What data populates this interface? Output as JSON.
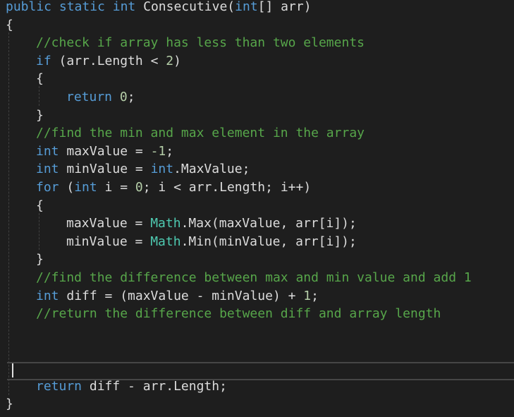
{
  "colors": {
    "background": "#1e1e1e",
    "keyword": "#569cd6",
    "comment": "#57a64a",
    "type": "#4ec9b0",
    "number": "#b5cea8",
    "plain": "#dcdcdc"
  },
  "editor": {
    "cursor_line": 20,
    "lines": [
      {
        "indent": 0,
        "tokens": [
          {
            "t": "public",
            "c": "kw"
          },
          {
            "t": " "
          },
          {
            "t": "static",
            "c": "kw"
          },
          {
            "t": " "
          },
          {
            "t": "int",
            "c": "kw"
          },
          {
            "t": " Consecutive("
          },
          {
            "t": "int",
            "c": "kw"
          },
          {
            "t": "[] arr)"
          }
        ]
      },
      {
        "indent": 0,
        "tokens": [
          {
            "t": "{"
          }
        ]
      },
      {
        "indent": 1,
        "tokens": [
          {
            "t": "//check if array has less than two elements",
            "c": "cm"
          }
        ]
      },
      {
        "indent": 1,
        "tokens": [
          {
            "t": "if",
            "c": "kw"
          },
          {
            "t": " (arr.Length < "
          },
          {
            "t": "2",
            "c": "nm"
          },
          {
            "t": ")"
          }
        ]
      },
      {
        "indent": 1,
        "tokens": [
          {
            "t": "{"
          }
        ]
      },
      {
        "indent": 2,
        "tokens": [
          {
            "t": "return",
            "c": "kw"
          },
          {
            "t": " "
          },
          {
            "t": "0",
            "c": "nm"
          },
          {
            "t": ";"
          }
        ]
      },
      {
        "indent": 1,
        "tokens": [
          {
            "t": "}"
          }
        ]
      },
      {
        "indent": 1,
        "tokens": [
          {
            "t": "//find the min and max element in the array",
            "c": "cm"
          }
        ]
      },
      {
        "indent": 1,
        "tokens": [
          {
            "t": "int",
            "c": "kw"
          },
          {
            "t": " maxValue = "
          },
          {
            "t": "-1",
            "c": "nm"
          },
          {
            "t": ";"
          }
        ]
      },
      {
        "indent": 1,
        "tokens": [
          {
            "t": "int",
            "c": "kw"
          },
          {
            "t": " minValue = "
          },
          {
            "t": "int",
            "c": "kw"
          },
          {
            "t": ".MaxValue;"
          }
        ]
      },
      {
        "indent": 1,
        "tokens": [
          {
            "t": "for",
            "c": "kw"
          },
          {
            "t": " ("
          },
          {
            "t": "int",
            "c": "kw"
          },
          {
            "t": " i = "
          },
          {
            "t": "0",
            "c": "nm"
          },
          {
            "t": "; i < arr.Length; i++)"
          }
        ]
      },
      {
        "indent": 1,
        "tokens": [
          {
            "t": "{"
          }
        ]
      },
      {
        "indent": 2,
        "tokens": [
          {
            "t": "maxValue = "
          },
          {
            "t": "Math",
            "c": "ty"
          },
          {
            "t": ".Max(maxValue, arr[i]);"
          }
        ]
      },
      {
        "indent": 2,
        "tokens": [
          {
            "t": "minValue = "
          },
          {
            "t": "Math",
            "c": "ty"
          },
          {
            "t": ".Min(minValue, arr[i]);"
          }
        ]
      },
      {
        "indent": 1,
        "tokens": [
          {
            "t": "}"
          }
        ]
      },
      {
        "indent": 1,
        "tokens": [
          {
            "t": "//find the difference between max and min value and add 1",
            "c": "cm"
          }
        ]
      },
      {
        "indent": 1,
        "tokens": [
          {
            "t": "int",
            "c": "kw"
          },
          {
            "t": " diff = (maxValue - minValue) + "
          },
          {
            "t": "1",
            "c": "nm"
          },
          {
            "t": ";"
          }
        ]
      },
      {
        "indent": 1,
        "tokens": [
          {
            "t": "//return the difference between diff and array length",
            "c": "cm"
          }
        ]
      },
      {
        "indent": 0,
        "tokens": []
      },
      {
        "indent": 0,
        "tokens": []
      },
      {
        "indent": 0,
        "tokens": []
      },
      {
        "indent": 1,
        "tokens": [
          {
            "t": "return",
            "c": "kw"
          },
          {
            "t": " diff - arr.Length;"
          }
        ]
      },
      {
        "indent": 0,
        "tokens": [
          {
            "t": "}"
          }
        ]
      }
    ]
  }
}
